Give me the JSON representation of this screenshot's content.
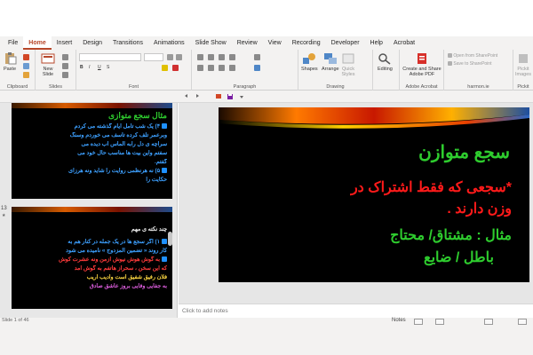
{
  "menu": {
    "tabs": [
      "File",
      "Home",
      "Insert",
      "Design",
      "Transitions",
      "Animations",
      "Slide Show",
      "Review",
      "View",
      "Recording",
      "Developer",
      "Help",
      "Acrobat"
    ],
    "active_tab": "Home"
  },
  "ribbon": {
    "clipboard": {
      "label": "Clipboard",
      "paste": "Paste"
    },
    "slides": {
      "label": "Slides",
      "new_slide": "New\nSlide"
    },
    "font": {
      "label": "Font"
    },
    "paragraph": {
      "label": "Paragraph"
    },
    "drawing": {
      "label": "Drawing",
      "shapes": "Shapes",
      "arrange": "Arrange",
      "quick_styles": "Quick\nStyles"
    },
    "editing": {
      "label": "",
      "editing": "Editing"
    },
    "adobe": {
      "label": "Adobe Acrobat",
      "create_share": "Create and Share\nAdobe PDF"
    },
    "harmon": {
      "label": "harmon.ie",
      "open_sp": "Open from SharePoint",
      "save_sp": "Save to SharePoint"
    },
    "pickit": {
      "label": "Pickit",
      "btn": "Pickit\nImages"
    }
  },
  "thumbnails": [
    {
      "lines": [
        {
          "text": "مثال سجع متوازی",
          "color": "#2ecc2e"
        },
        {
          "text": "۴) یک شب تأمل ایام گذشته می کردم",
          "color": "#3da0ff",
          "bullet": true
        },
        {
          "text": "وبرعمر تلف کرده تأسف می خوردم وسنگ",
          "color": "#3da0ff"
        },
        {
          "text": "سراچه ی دل رابه الماس آب دیده می",
          "color": "#3da0ff"
        },
        {
          "text": "سفتم واین بیت ها مناسب حال خود می",
          "color": "#3da0ff"
        },
        {
          "text": "گفتم.",
          "color": "#3da0ff"
        },
        {
          "text": "۵) نه هرنظمی روایت را شاید ونه هرزای",
          "color": "#3da0ff",
          "bullet": true
        },
        {
          "text": "حکایت را",
          "color": "#3da0ff"
        }
      ]
    },
    {
      "number": "13",
      "lines": [
        {
          "text": "چند نکته ی مهم",
          "color": "#eeeeee"
        },
        {
          "text": "۱) اگر سجع ها در یک جمله در کنار هم به",
          "color": "#3da0ff",
          "bullet": true
        },
        {
          "text": "کار روند « تضمین المزدوج » نامیده می شود",
          "color": "#3da0ff"
        },
        {
          "text": "به گوش هوش نیوش ازمن ونه عشرت کوش",
          "color": "#ff3b3b",
          "bullet": true
        },
        {
          "text": "که این سخن ، سحراز هاتفم به گوش آمد",
          "color": "#ff3b3b"
        },
        {
          "text": "فلان رفیق شفیق است وادیب اریب",
          "color": "#f4d03f"
        },
        {
          "text": "به جفایی وفایی بروز عاشق صادق",
          "color": "#d65bd6"
        }
      ]
    }
  ],
  "slide": {
    "title": "سجع متوازن",
    "lines": [
      {
        "text": "*سجعی که فقط اشتراک در",
        "color": "#ff1a1a"
      },
      {
        "text": "وزن دارند .",
        "color": "#ff1a1a"
      },
      {
        "text": "مثال : مشتاق/ محتاج",
        "color": "#2ecc2e"
      },
      {
        "text": "باطل / ضایع",
        "color": "#2ecc2e"
      }
    ]
  },
  "notes": {
    "placeholder": "Click to add notes"
  },
  "status": {
    "slide_info": "Slide 1 of 46",
    "notes_btn": "Notes"
  }
}
